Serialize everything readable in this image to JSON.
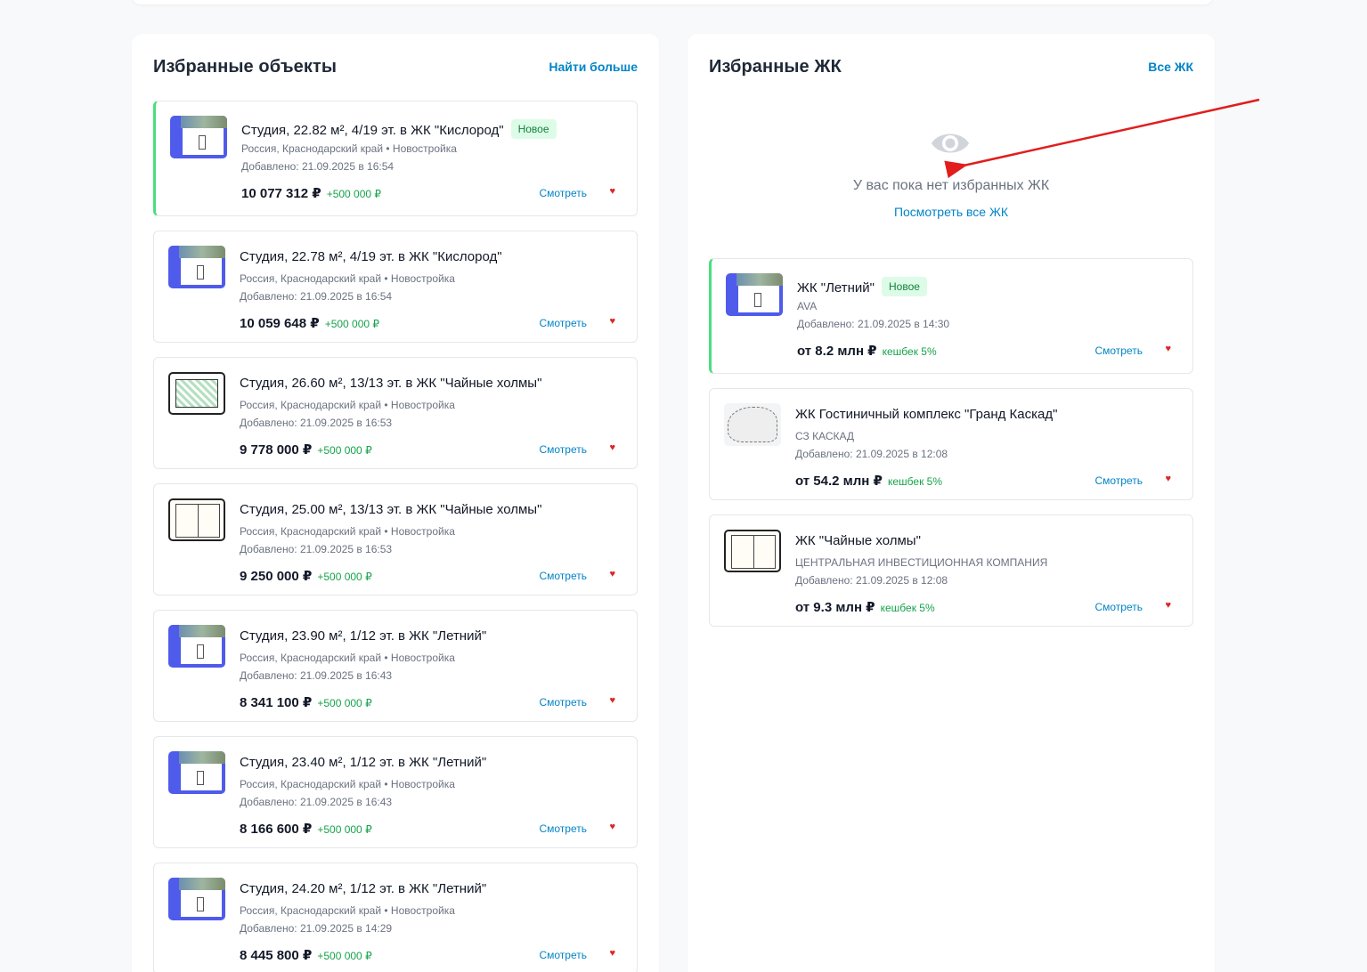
{
  "favorites_objects": {
    "title": "Избранные объекты",
    "more_link": "Найти больше",
    "items": [
      {
        "title": "Студия, 22.82 м², 4/19 эт. в ЖК \"Кислород\"",
        "badge": "Новое",
        "location": "Россия, Краснодарский край • Новостройка",
        "added": "Добавлено: 21.09.2025 в 16:54",
        "price": "10 077 312 ₽",
        "extra": "+500 000 ₽",
        "view": "Смотреть",
        "thumb": "render-icon"
      },
      {
        "title": "Студия, 22.78 м², 4/19 эт. в ЖК \"Кислород\"",
        "badge": "",
        "location": "Россия, Краснодарский край • Новостройка",
        "added": "Добавлено: 21.09.2025 в 16:54",
        "price": "10 059 648 ₽",
        "extra": "+500 000 ₽",
        "view": "Смотреть",
        "thumb": "render-icon"
      },
      {
        "title": "Студия, 26.60 м², 13/13 эт. в ЖК \"Чайные холмы\"",
        "badge": "",
        "location": "Россия, Краснодарский край • Новостройка",
        "added": "Добавлено: 21.09.2025 в 16:53",
        "price": "9 778 000 ₽",
        "extra": "+500 000 ₽",
        "view": "Смотреть",
        "thumb": "floorplan-icon"
      },
      {
        "title": "Студия, 25.00 м², 13/13 эт. в ЖК \"Чайные холмы\"",
        "badge": "",
        "location": "Россия, Краснодарский край • Новостройка",
        "added": "Добавлено: 21.09.2025 в 16:53",
        "price": "9 250 000 ₽",
        "extra": "+500 000 ₽",
        "view": "Смотреть",
        "thumb": "floorplan-icon"
      },
      {
        "title": "Студия, 23.90 м², 1/12 эт. в ЖК \"Летний\"",
        "badge": "",
        "location": "Россия, Краснодарский край • Новостройка",
        "added": "Добавлено: 21.09.2025 в 16:43",
        "price": "8 341 100 ₽",
        "extra": "+500 000 ₽",
        "view": "Смотреть",
        "thumb": "render-icon"
      },
      {
        "title": "Студия, 23.40 м², 1/12 эт. в ЖК \"Летний\"",
        "badge": "",
        "location": "Россия, Краснодарский край • Новостройка",
        "added": "Добавлено: 21.09.2025 в 16:43",
        "price": "8 166 600 ₽",
        "extra": "+500 000 ₽",
        "view": "Смотреть",
        "thumb": "render-icon"
      },
      {
        "title": "Студия, 24.20 м², 1/12 эт. в ЖК \"Летний\"",
        "badge": "",
        "location": "Россия, Краснодарский край • Новостройка",
        "added": "Добавлено: 21.09.2025 в 14:29",
        "price": "8 445 800 ₽",
        "extra": "+500 000 ₽",
        "view": "Смотреть",
        "thumb": "render-icon"
      }
    ]
  },
  "favorites_complexes": {
    "title": "Избранные ЖК",
    "all_link": "Все ЖК",
    "empty_text": "У вас пока нет избранных ЖК",
    "empty_link": "Посмотреть все ЖК",
    "empty_icon": "eye-icon",
    "items": [
      {
        "title": "ЖК \"Летний\"",
        "badge": "Новое",
        "developer": "AVA",
        "added": "Добавлено: 21.09.2025 в 14:30",
        "price": "от 8.2 млн ₽",
        "extra": "кешбек 5%",
        "view": "Смотреть"
      },
      {
        "title": "ЖК Гостиничный комплекс \"Гранд Каскад\"",
        "badge": "",
        "developer": "СЗ КАСКАД",
        "added": "Добавлено: 21.09.2025 в 12:08",
        "price": "от 54.2 млн ₽",
        "extra": "кешбек 5%",
        "view": "Смотреть"
      },
      {
        "title": "ЖК \"Чайные холмы\"",
        "badge": "",
        "developer": "ЦЕНТРАЛЬНАЯ ИНВЕСТИЦИОННАЯ КОМПАНИЯ",
        "added": "Добавлено: 21.09.2025 в 12:08",
        "price": "от 9.3 млн ₽",
        "extra": "кешбек 5%",
        "view": "Смотреть"
      }
    ]
  },
  "colors": {
    "accent": "#0284c7",
    "success": "#16a34a",
    "badge_bg": "#dcfce7",
    "heart": "#dc2626",
    "annotation_arrow": "#e11d1d"
  }
}
